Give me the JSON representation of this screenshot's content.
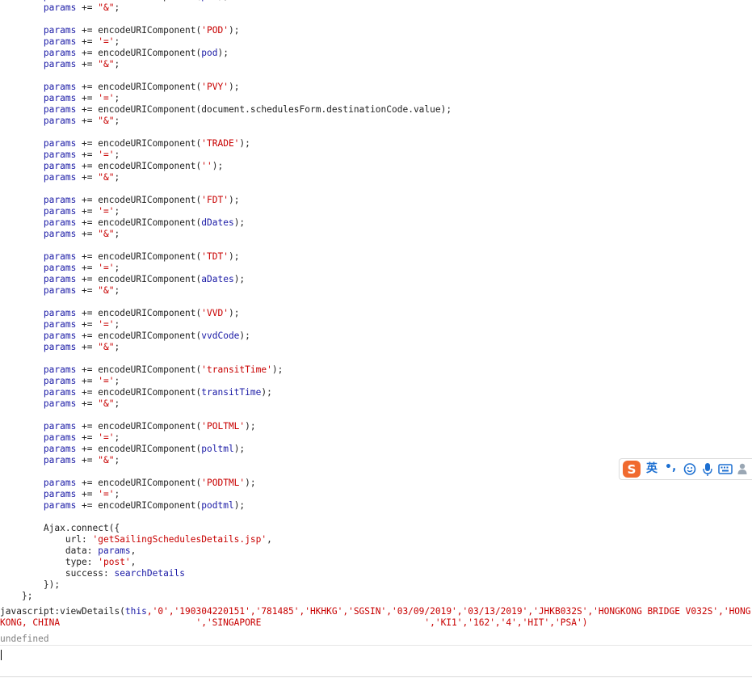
{
  "code_lines": [
    [
      [
        "        ",
        "p"
      ],
      [
        "params",
        "v"
      ],
      [
        " += ",
        "p"
      ],
      [
        "encodeURIComponent",
        "f"
      ],
      [
        "(",
        "p"
      ],
      [
        "pol",
        "i"
      ],
      [
        ");",
        "p"
      ]
    ],
    [
      [
        "        ",
        "p"
      ],
      [
        "params",
        "v"
      ],
      [
        " += ",
        "p"
      ],
      [
        "\"&\"",
        "s"
      ],
      [
        ";",
        "p"
      ]
    ],
    [],
    [
      [
        "        ",
        "p"
      ],
      [
        "params",
        "v"
      ],
      [
        " += ",
        "p"
      ],
      [
        "encodeURIComponent",
        "f"
      ],
      [
        "(",
        "p"
      ],
      [
        "'POD'",
        "s"
      ],
      [
        ");",
        "p"
      ]
    ],
    [
      [
        "        ",
        "p"
      ],
      [
        "params",
        "v"
      ],
      [
        " += ",
        "p"
      ],
      [
        "'='",
        "s"
      ],
      [
        ";",
        "p"
      ]
    ],
    [
      [
        "        ",
        "p"
      ],
      [
        "params",
        "v"
      ],
      [
        " += ",
        "p"
      ],
      [
        "encodeURIComponent",
        "f"
      ],
      [
        "(",
        "p"
      ],
      [
        "pod",
        "i"
      ],
      [
        ");",
        "p"
      ]
    ],
    [
      [
        "        ",
        "p"
      ],
      [
        "params",
        "v"
      ],
      [
        " += ",
        "p"
      ],
      [
        "\"&\"",
        "s"
      ],
      [
        ";",
        "p"
      ]
    ],
    [],
    [
      [
        "        ",
        "p"
      ],
      [
        "params",
        "v"
      ],
      [
        " += ",
        "p"
      ],
      [
        "encodeURIComponent",
        "f"
      ],
      [
        "(",
        "p"
      ],
      [
        "'PVY'",
        "s"
      ],
      [
        ");",
        "p"
      ]
    ],
    [
      [
        "        ",
        "p"
      ],
      [
        "params",
        "v"
      ],
      [
        " += ",
        "p"
      ],
      [
        "'='",
        "s"
      ],
      [
        ";",
        "p"
      ]
    ],
    [
      [
        "        ",
        "p"
      ],
      [
        "params",
        "v"
      ],
      [
        " += ",
        "p"
      ],
      [
        "encodeURIComponent",
        "f"
      ],
      [
        "(",
        "p"
      ],
      [
        "document.schedulesForm.destinationCode.value",
        "m"
      ],
      [
        ");",
        "p"
      ]
    ],
    [
      [
        "        ",
        "p"
      ],
      [
        "params",
        "v"
      ],
      [
        " += ",
        "p"
      ],
      [
        "\"&\"",
        "s"
      ],
      [
        ";",
        "p"
      ]
    ],
    [],
    [
      [
        "        ",
        "p"
      ],
      [
        "params",
        "v"
      ],
      [
        " += ",
        "p"
      ],
      [
        "encodeURIComponent",
        "f"
      ],
      [
        "(",
        "p"
      ],
      [
        "'TRADE'",
        "s"
      ],
      [
        ");",
        "p"
      ]
    ],
    [
      [
        "        ",
        "p"
      ],
      [
        "params",
        "v"
      ],
      [
        " += ",
        "p"
      ],
      [
        "'='",
        "s"
      ],
      [
        ";",
        "p"
      ]
    ],
    [
      [
        "        ",
        "p"
      ],
      [
        "params",
        "v"
      ],
      [
        " += ",
        "p"
      ],
      [
        "encodeURIComponent",
        "f"
      ],
      [
        "(",
        "p"
      ],
      [
        "''",
        "s"
      ],
      [
        ");",
        "p"
      ]
    ],
    [
      [
        "        ",
        "p"
      ],
      [
        "params",
        "v"
      ],
      [
        " += ",
        "p"
      ],
      [
        "\"&\"",
        "s"
      ],
      [
        ";",
        "p"
      ]
    ],
    [],
    [
      [
        "        ",
        "p"
      ],
      [
        "params",
        "v"
      ],
      [
        " += ",
        "p"
      ],
      [
        "encodeURIComponent",
        "f"
      ],
      [
        "(",
        "p"
      ],
      [
        "'FDT'",
        "s"
      ],
      [
        ");",
        "p"
      ]
    ],
    [
      [
        "        ",
        "p"
      ],
      [
        "params",
        "v"
      ],
      [
        " += ",
        "p"
      ],
      [
        "'='",
        "s"
      ],
      [
        ";",
        "p"
      ]
    ],
    [
      [
        "        ",
        "p"
      ],
      [
        "params",
        "v"
      ],
      [
        " += ",
        "p"
      ],
      [
        "encodeURIComponent",
        "f"
      ],
      [
        "(",
        "p"
      ],
      [
        "dDates",
        "i"
      ],
      [
        ");",
        "p"
      ]
    ],
    [
      [
        "        ",
        "p"
      ],
      [
        "params",
        "v"
      ],
      [
        " += ",
        "p"
      ],
      [
        "\"&\"",
        "s"
      ],
      [
        ";",
        "p"
      ]
    ],
    [],
    [
      [
        "        ",
        "p"
      ],
      [
        "params",
        "v"
      ],
      [
        " += ",
        "p"
      ],
      [
        "encodeURIComponent",
        "f"
      ],
      [
        "(",
        "p"
      ],
      [
        "'TDT'",
        "s"
      ],
      [
        ");",
        "p"
      ]
    ],
    [
      [
        "        ",
        "p"
      ],
      [
        "params",
        "v"
      ],
      [
        " += ",
        "p"
      ],
      [
        "'='",
        "s"
      ],
      [
        ";",
        "p"
      ]
    ],
    [
      [
        "        ",
        "p"
      ],
      [
        "params",
        "v"
      ],
      [
        " += ",
        "p"
      ],
      [
        "encodeURIComponent",
        "f"
      ],
      [
        "(",
        "p"
      ],
      [
        "aDates",
        "i"
      ],
      [
        ");",
        "p"
      ]
    ],
    [
      [
        "        ",
        "p"
      ],
      [
        "params",
        "v"
      ],
      [
        " += ",
        "p"
      ],
      [
        "\"&\"",
        "s"
      ],
      [
        ";",
        "p"
      ]
    ],
    [],
    [
      [
        "        ",
        "p"
      ],
      [
        "params",
        "v"
      ],
      [
        " += ",
        "p"
      ],
      [
        "encodeURIComponent",
        "f"
      ],
      [
        "(",
        "p"
      ],
      [
        "'VVD'",
        "s"
      ],
      [
        ");",
        "p"
      ]
    ],
    [
      [
        "        ",
        "p"
      ],
      [
        "params",
        "v"
      ],
      [
        " += ",
        "p"
      ],
      [
        "'='",
        "s"
      ],
      [
        ";",
        "p"
      ]
    ],
    [
      [
        "        ",
        "p"
      ],
      [
        "params",
        "v"
      ],
      [
        " += ",
        "p"
      ],
      [
        "encodeURIComponent",
        "f"
      ],
      [
        "(",
        "p"
      ],
      [
        "vvdCode",
        "i"
      ],
      [
        ");",
        "p"
      ]
    ],
    [
      [
        "        ",
        "p"
      ],
      [
        "params",
        "v"
      ],
      [
        " += ",
        "p"
      ],
      [
        "\"&\"",
        "s"
      ],
      [
        ";",
        "p"
      ]
    ],
    [],
    [
      [
        "        ",
        "p"
      ],
      [
        "params",
        "v"
      ],
      [
        " += ",
        "p"
      ],
      [
        "encodeURIComponent",
        "f"
      ],
      [
        "(",
        "p"
      ],
      [
        "'transitTime'",
        "s"
      ],
      [
        ");",
        "p"
      ]
    ],
    [
      [
        "        ",
        "p"
      ],
      [
        "params",
        "v"
      ],
      [
        " += ",
        "p"
      ],
      [
        "'='",
        "s"
      ],
      [
        ";",
        "p"
      ]
    ],
    [
      [
        "        ",
        "p"
      ],
      [
        "params",
        "v"
      ],
      [
        " += ",
        "p"
      ],
      [
        "encodeURIComponent",
        "f"
      ],
      [
        "(",
        "p"
      ],
      [
        "transitTime",
        "i"
      ],
      [
        ");",
        "p"
      ]
    ],
    [
      [
        "        ",
        "p"
      ],
      [
        "params",
        "v"
      ],
      [
        " += ",
        "p"
      ],
      [
        "\"&\"",
        "s"
      ],
      [
        ";",
        "p"
      ]
    ],
    [],
    [
      [
        "        ",
        "p"
      ],
      [
        "params",
        "v"
      ],
      [
        " += ",
        "p"
      ],
      [
        "encodeURIComponent",
        "f"
      ],
      [
        "(",
        "p"
      ],
      [
        "'POLTML'",
        "s"
      ],
      [
        ");",
        "p"
      ]
    ],
    [
      [
        "        ",
        "p"
      ],
      [
        "params",
        "v"
      ],
      [
        " += ",
        "p"
      ],
      [
        "'='",
        "s"
      ],
      [
        ";",
        "p"
      ]
    ],
    [
      [
        "        ",
        "p"
      ],
      [
        "params",
        "v"
      ],
      [
        " += ",
        "p"
      ],
      [
        "encodeURIComponent",
        "f"
      ],
      [
        "(",
        "p"
      ],
      [
        "poltml",
        "i"
      ],
      [
        ");",
        "p"
      ]
    ],
    [
      [
        "        ",
        "p"
      ],
      [
        "params",
        "v"
      ],
      [
        " += ",
        "p"
      ],
      [
        "\"&\"",
        "s"
      ],
      [
        ";",
        "p"
      ]
    ],
    [],
    [
      [
        "        ",
        "p"
      ],
      [
        "params",
        "v"
      ],
      [
        " += ",
        "p"
      ],
      [
        "encodeURIComponent",
        "f"
      ],
      [
        "(",
        "p"
      ],
      [
        "'PODTML'",
        "s"
      ],
      [
        ");",
        "p"
      ]
    ],
    [
      [
        "        ",
        "p"
      ],
      [
        "params",
        "v"
      ],
      [
        " += ",
        "p"
      ],
      [
        "'='",
        "s"
      ],
      [
        ";",
        "p"
      ]
    ],
    [
      [
        "        ",
        "p"
      ],
      [
        "params",
        "v"
      ],
      [
        " += ",
        "p"
      ],
      [
        "encodeURIComponent",
        "f"
      ],
      [
        "(",
        "p"
      ],
      [
        "podtml",
        "i"
      ],
      [
        ");",
        "p"
      ]
    ],
    [],
    [
      [
        "        ",
        "p"
      ],
      [
        "Ajax",
        "k"
      ],
      [
        ".connect({",
        "p"
      ]
    ],
    [
      [
        "            ",
        "p"
      ],
      [
        "url: ",
        "p"
      ],
      [
        "'getSailingSchedulesDetails.jsp'",
        "s"
      ],
      [
        ",",
        "p"
      ]
    ],
    [
      [
        "            ",
        "p"
      ],
      [
        "data: ",
        "p"
      ],
      [
        "params",
        "v"
      ],
      [
        ",",
        "p"
      ]
    ],
    [
      [
        "            ",
        "p"
      ],
      [
        "type: ",
        "p"
      ],
      [
        "'post'",
        "s"
      ],
      [
        ",",
        "p"
      ]
    ],
    [
      [
        "            ",
        "p"
      ],
      [
        "success: ",
        "p"
      ],
      [
        "searchDetails",
        "i"
      ]
    ],
    [
      [
        "        ",
        "p"
      ],
      [
        "});",
        "p"
      ]
    ],
    [
      [
        "    ",
        "p"
      ],
      [
        "};",
        "p"
      ]
    ]
  ],
  "result_line": {
    "prefix": "javascript:viewDetails(",
    "this_kw": "this",
    "args": ",'0','190304220151','781485','HKHKG','SGSIN','03/09/2019','03/13/2019','JHKB032S','HONGKONG BRIDGE V032S','HONG\nKONG, CHINA                         ','SINGAPORE                              ','KI1','162','4','HIT','PSA')"
  },
  "return_value": "undefined",
  "ime_toolbar": {
    "logo_icon": "sogou-s-icon",
    "language_label": "英",
    "punct_label": "•,",
    "icons": [
      "emoji-face-icon",
      "microphone-icon",
      "keyboard-icon",
      "user-icon"
    ],
    "accent_color": "#1c6fd1",
    "logo_color": "#f06a2f"
  },
  "colors": {
    "keyword_blue": "#1a1aa6",
    "string_red": "#c80000",
    "undefined_gray": "#808080"
  }
}
